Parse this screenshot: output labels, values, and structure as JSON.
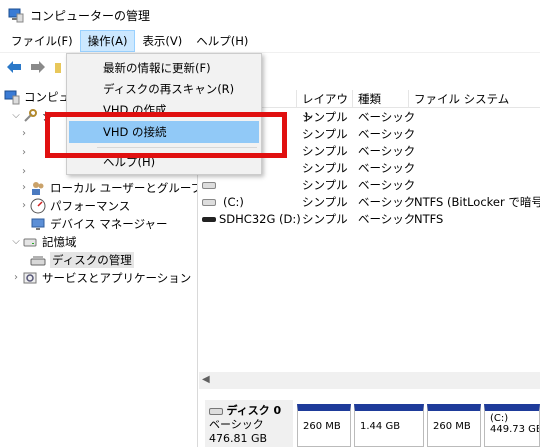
{
  "window": {
    "title": "コンピューターの管理"
  },
  "menubar": {
    "items": [
      {
        "label": "ファイル(F)"
      },
      {
        "label": "操作(A)"
      },
      {
        "label": "表示(V)"
      },
      {
        "label": "ヘルプ(H)"
      }
    ]
  },
  "dropdown": {
    "items": [
      {
        "label": "最新の情報に更新(F)"
      },
      {
        "label": "ディスクの再スキャン(R)"
      },
      {
        "label": "VHD の作成"
      },
      {
        "label": "VHD の接続"
      },
      {
        "label": "ヘルプ(H)"
      }
    ]
  },
  "tree": {
    "root_label": "コンピュ",
    "items": [
      {
        "label": "シ"
      },
      {
        "label": "ローカル ユーザーとグループ"
      },
      {
        "label": "パフォーマンス"
      },
      {
        "label": "デバイス マネージャー"
      },
      {
        "label": "記憶域"
      },
      {
        "label": "ディスクの管理"
      },
      {
        "label": "サービスとアプリケーション"
      }
    ]
  },
  "volumes": {
    "headers": [
      "レイアウト",
      "種類",
      "ファイル システム"
    ],
    "rows": [
      {
        "name": "",
        "layout": "シンプル",
        "type": "ベーシック",
        "fs": ""
      },
      {
        "name": "",
        "layout": "シンプル",
        "type": "ベーシック",
        "fs": ""
      },
      {
        "name": "",
        "layout": "シンプル",
        "type": "ベーシック",
        "fs": ""
      },
      {
        "name": "",
        "layout": "シンプル",
        "type": "ベーシック",
        "fs": ""
      },
      {
        "name": "",
        "layout": "シンプル",
        "type": "ベーシック",
        "fs": ""
      },
      {
        "name": "(C:)",
        "layout": "シンプル",
        "type": "ベーシック",
        "fs": "NTFS (BitLocker で暗号化"
      },
      {
        "name": "SDHC32G (D:)",
        "layout": "シンプル",
        "type": "ベーシック",
        "fs": "NTFS"
      }
    ]
  },
  "graph": {
    "disk_name": "ディスク 0",
    "disk_type": "ベーシック",
    "disk_size": "476.81 GB",
    "partitions": [
      {
        "label": "260 MB"
      },
      {
        "label": "1.44 GB"
      },
      {
        "label": "260 MB"
      },
      {
        "label": "(C:)"
      }
    ],
    "c_size": "449.73 GB"
  },
  "colors": {
    "highlight": "#91c9f7",
    "menu_active": "#cce8ff",
    "partition_bar": "#1e3b9a",
    "annotation": "#e01010"
  }
}
